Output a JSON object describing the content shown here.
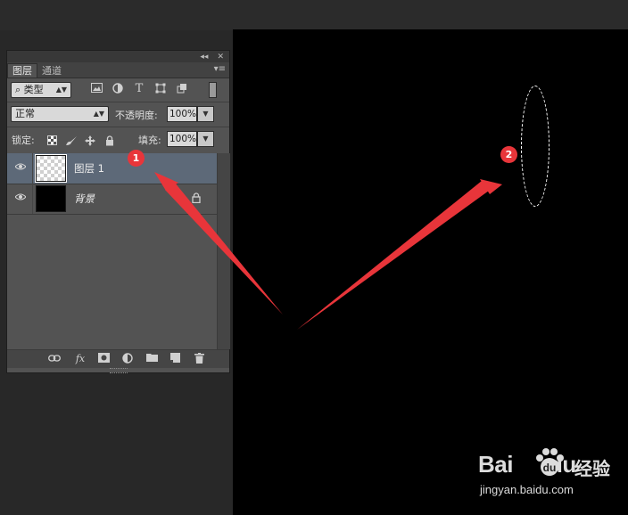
{
  "panel": {
    "top_controls": {
      "collapse": "◂◂",
      "close": "✕"
    },
    "tabs": [
      {
        "label": "图层"
      },
      {
        "label": "通道"
      }
    ],
    "menu_glyph": "▾≡",
    "filter": {
      "search_glyph": "⌕",
      "kind_label": "类型"
    },
    "blend": {
      "mode": "正常",
      "opacity_label": "不透明度:",
      "opacity_value": "100%"
    },
    "lock": {
      "label": "锁定:",
      "fill_label": "填充:",
      "fill_value": "100%"
    },
    "layers": [
      {
        "name": "图层 1",
        "selected": true,
        "thumbnail": "transparent"
      },
      {
        "name": "背景",
        "selected": false,
        "thumbnail": "black",
        "locked": true
      }
    ],
    "bottom_icons": [
      "link-icon",
      "fx-icon",
      "mask-icon",
      "adjustment-icon",
      "folder-icon",
      "new-layer-icon",
      "trash-icon"
    ],
    "fx_glyph": "fx"
  },
  "annotations": [
    {
      "label": "1"
    },
    {
      "label": "2"
    }
  ],
  "colors": {
    "accent": "#e8353a",
    "canvas": "#000000",
    "selected_layer": "#5d6978",
    "panel": "#535353"
  },
  "watermark": {
    "logo": "Bai",
    "logo_tail": "du",
    "cn": "经验",
    "url": "jingyan.baidu.com"
  }
}
